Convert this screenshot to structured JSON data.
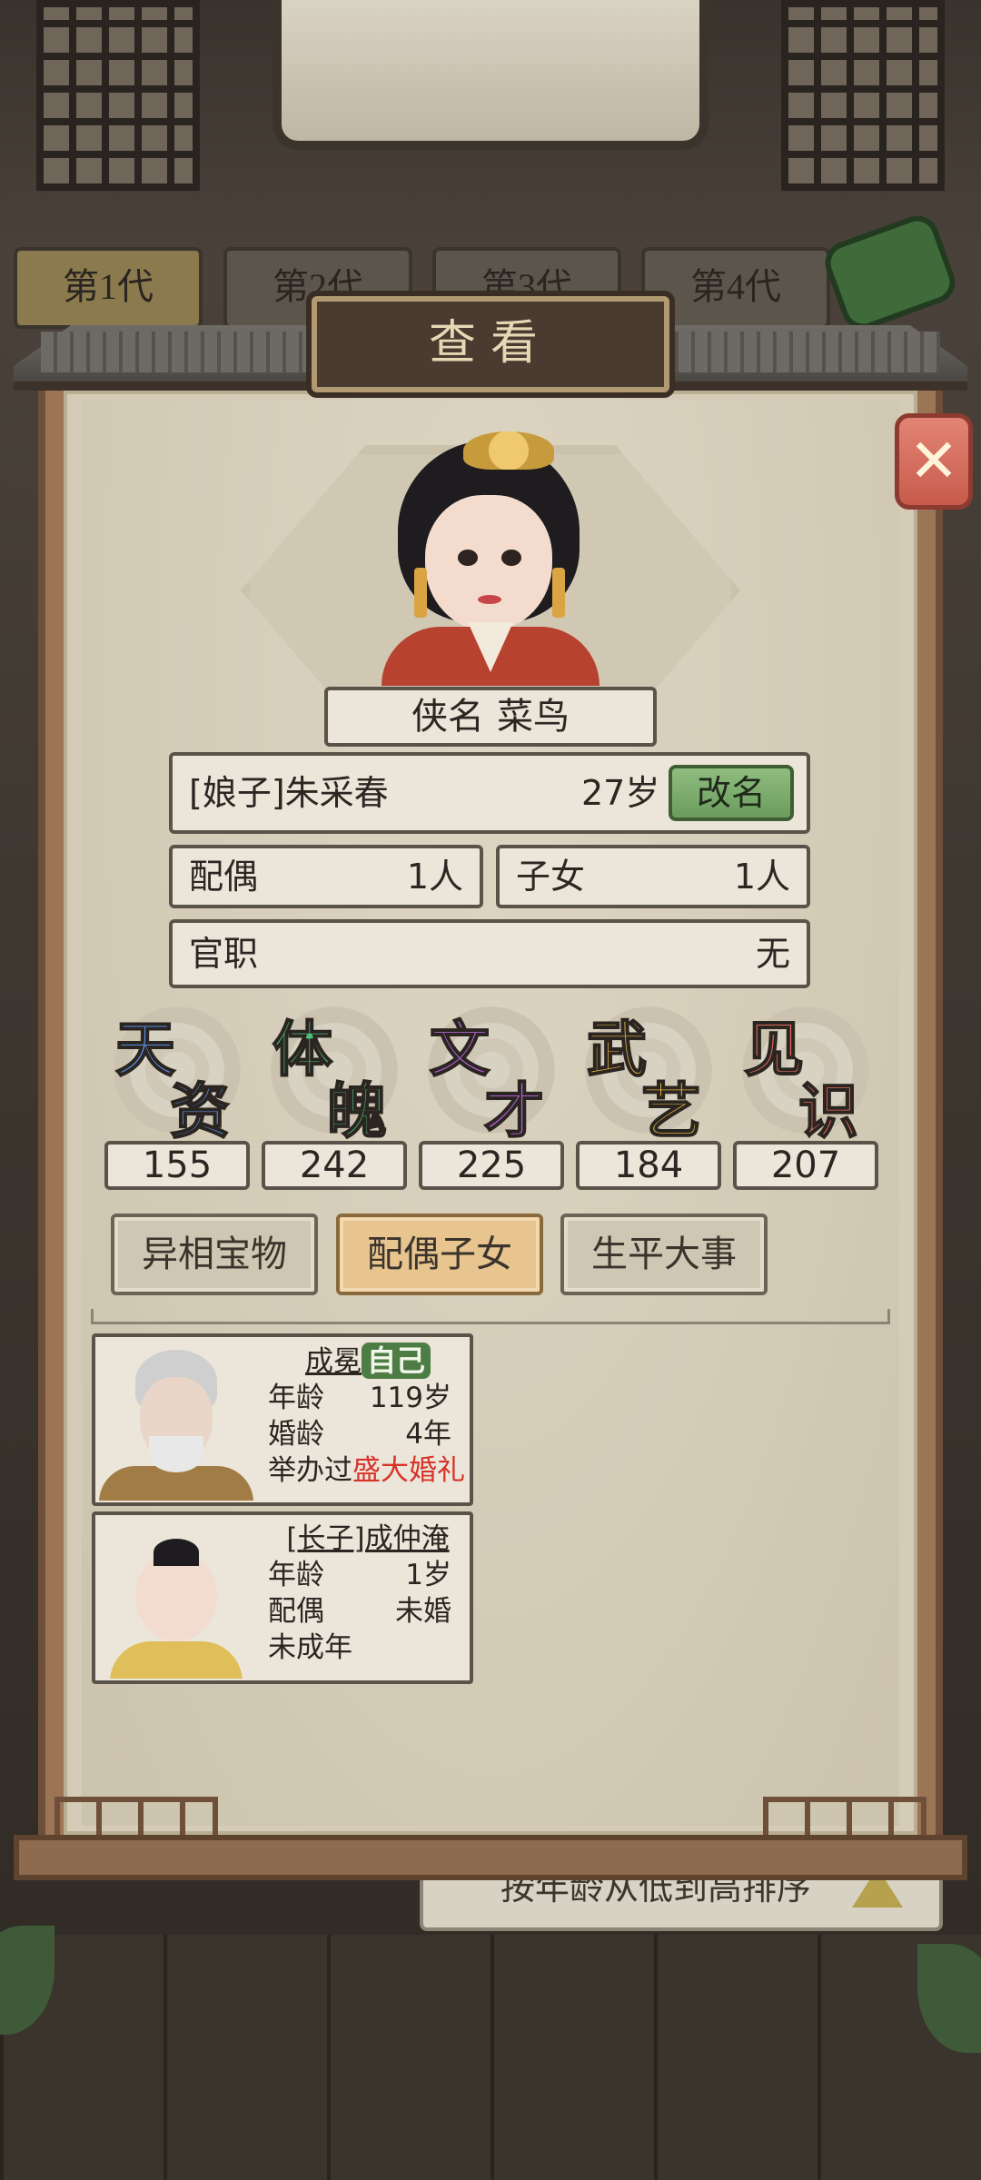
{
  "generation_tabs": [
    "第1代",
    "第2代",
    "第3代",
    "第4代"
  ],
  "sort_label": "按年龄从低到高排序",
  "dialog": {
    "title": "查看",
    "close_icon": "close-x-icon",
    "nickname_label": "侠名",
    "nickname_value": "菜鸟",
    "name": "[娘子]朱采春",
    "age": "27岁",
    "rename_button": "改名",
    "spouse_label": "配偶",
    "spouse_value": "1人",
    "children_label": "子女",
    "children_value": "1人",
    "office_label": "官职",
    "office_value": "无"
  },
  "attributes": [
    {
      "chars": [
        "天",
        "资"
      ],
      "value": "155",
      "color": "#5a8fe8"
    },
    {
      "chars": [
        "体",
        "魄"
      ],
      "value": "242",
      "color": "#4dc07a"
    },
    {
      "chars": [
        "文",
        "才"
      ],
      "value": "225",
      "color": "#b462d6"
    },
    {
      "chars": [
        "武",
        "艺"
      ],
      "value": "184",
      "color": "#e9b544"
    },
    {
      "chars": [
        "见",
        "识"
      ],
      "value": "207",
      "color": "#e56a5e"
    }
  ],
  "tabs": [
    {
      "label": "异相宝物",
      "active": false
    },
    {
      "label": "配偶子女",
      "active": true
    },
    {
      "label": "生平大事",
      "active": false
    }
  ],
  "members": [
    {
      "name": "成冕",
      "badge": "自己",
      "rows": [
        {
          "k": "年龄",
          "v": "119岁"
        },
        {
          "k": "婚龄",
          "v": "4年"
        }
      ],
      "extra_prefix": "举办过",
      "extra_highlight": "盛大婚礼"
    },
    {
      "name": "[长子]成仲淹",
      "rows": [
        {
          "k": "年龄",
          "v": "1岁"
        },
        {
          "k": "配偶",
          "v": "未婚"
        }
      ],
      "extra_prefix": "未成年"
    }
  ]
}
